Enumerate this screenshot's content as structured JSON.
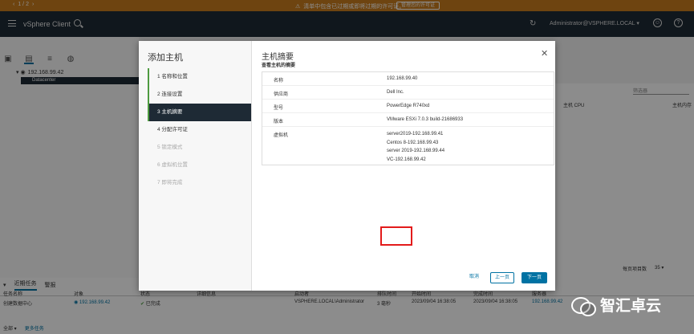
{
  "warning": {
    "pager": "1 / 2",
    "message": "清单中包含已过期或即将过期的许可证。",
    "manage_button": "管理您的许可证"
  },
  "header": {
    "app_title": "vSphere Client",
    "user": "Administrator@VSPHERE.LOCAL ▾"
  },
  "navigator": {
    "host": "192.168.99.42",
    "datacenter": "Datacenter"
  },
  "background": {
    "filter_placeholder": "筛选器",
    "col_cpu": "主机 CPU",
    "col_mem": "主机内存",
    "page_size_label": "每页项目数",
    "page_size_value": "35 ▾"
  },
  "tasks": {
    "tab_recent": "近期任务",
    "tab_alarms": "警报",
    "headers": [
      "任务名称",
      "对象",
      "状态",
      "详细信息",
      "启动者",
      "排队时间",
      "开始时间",
      "完成时间",
      "服务器"
    ],
    "row": {
      "name": "创建数据中心",
      "object": "192.168.99.42",
      "status": "已完成",
      "initiator": "VSPHERE.LOCAL\\Administrator",
      "queue": "3 毫秒",
      "start": "2023/09/04 16:38:05",
      "finish": "2023/09/04 16:38:05",
      "server": "192.168.99.42"
    },
    "footer_all": "全部 ▾",
    "footer_more": "更多任务"
  },
  "dialog": {
    "title": "添加主机",
    "steps": [
      {
        "label": "1  名称和位置"
      },
      {
        "label": "2  连接设置"
      },
      {
        "label": "3  主机摘要"
      },
      {
        "label": "4  分配许可证"
      },
      {
        "label": "5  锁定模式"
      },
      {
        "label": "6  虚拟机位置"
      },
      {
        "label": "7  即将完成"
      }
    ],
    "content_title": "主机摘要",
    "content_subtitle": "查看主机的摘要",
    "summary": {
      "name_key": "名称",
      "name_val": "192.168.99.40",
      "vendor_key": "供应商",
      "vendor_val": "Dell Inc.",
      "model_key": "型号",
      "model_val": "PowerEdge R740xd",
      "version_key": "版本",
      "version_val": "VMware ESXi 7.0.3 build-21686933",
      "vm_key": "虚拟机",
      "vms": [
        "server2019-192.168.99.41",
        "Centos 8-192.168.99.43",
        "server 2019-192.168.99.44",
        "VC-192.168.99.42"
      ]
    },
    "buttons": {
      "cancel": "取消",
      "back": "上一页",
      "next": "下一页"
    }
  },
  "watermark": {
    "text": "智汇卓云"
  }
}
